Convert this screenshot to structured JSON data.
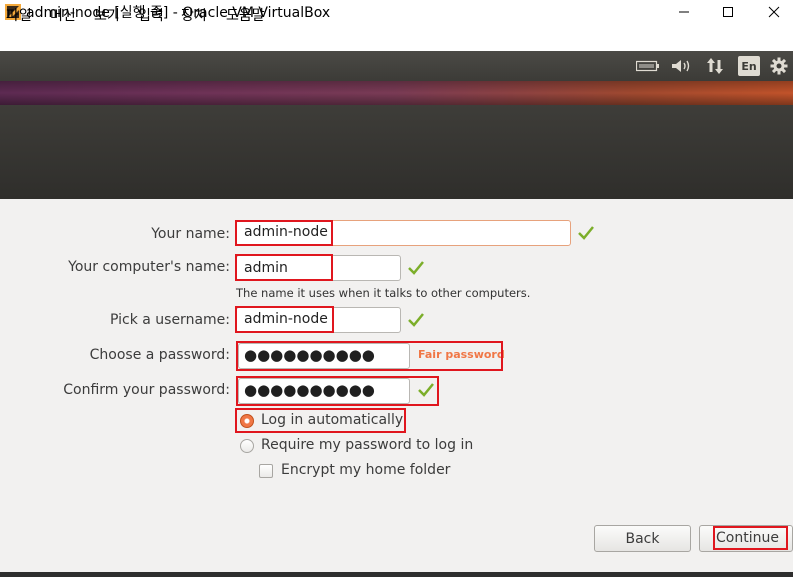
{
  "window": {
    "title": "admin-node [실행 중] - Oracle VM VirtualBox",
    "minimize_symbol": "—",
    "maximize_symbol": "☐",
    "close_symbol": "✕"
  },
  "menu": [
    "파일",
    "머신",
    "보기",
    "입력",
    "장치",
    "도움말"
  ],
  "panel": {
    "icons": [
      "battery-icon",
      "volume-icon",
      "network-icon",
      "gear-icon"
    ],
    "language": "En"
  },
  "form": {
    "your_name": {
      "label": "Your name:",
      "value": "admin-node",
      "valid": true
    },
    "computer_name": {
      "label": "Your computer's name:",
      "value": "admin",
      "hint": "The name it uses when it talks to other computers.",
      "valid": true
    },
    "username": {
      "label": "Pick a username:",
      "value": "admin-node",
      "valid": true
    },
    "password": {
      "label": "Choose a password:",
      "masked": "●●●●●●●●●●",
      "strength": "Fair password",
      "strength_color": "#f07746"
    },
    "confirm_password": {
      "label": "Confirm your password:",
      "masked": "●●●●●●●●●●",
      "valid": true
    },
    "login_options": [
      {
        "label": "Log in automatically",
        "selected": true
      },
      {
        "label": "Require my password to log in",
        "selected": false
      }
    ],
    "encrypt_home": {
      "label": "Encrypt my home folder",
      "checked": false
    }
  },
  "buttons": {
    "back": "Back",
    "continue": "Continue"
  },
  "colors": {
    "accent": "#dd4814",
    "check_green": "#7cae2a",
    "highlight_red": "#e0161e"
  }
}
